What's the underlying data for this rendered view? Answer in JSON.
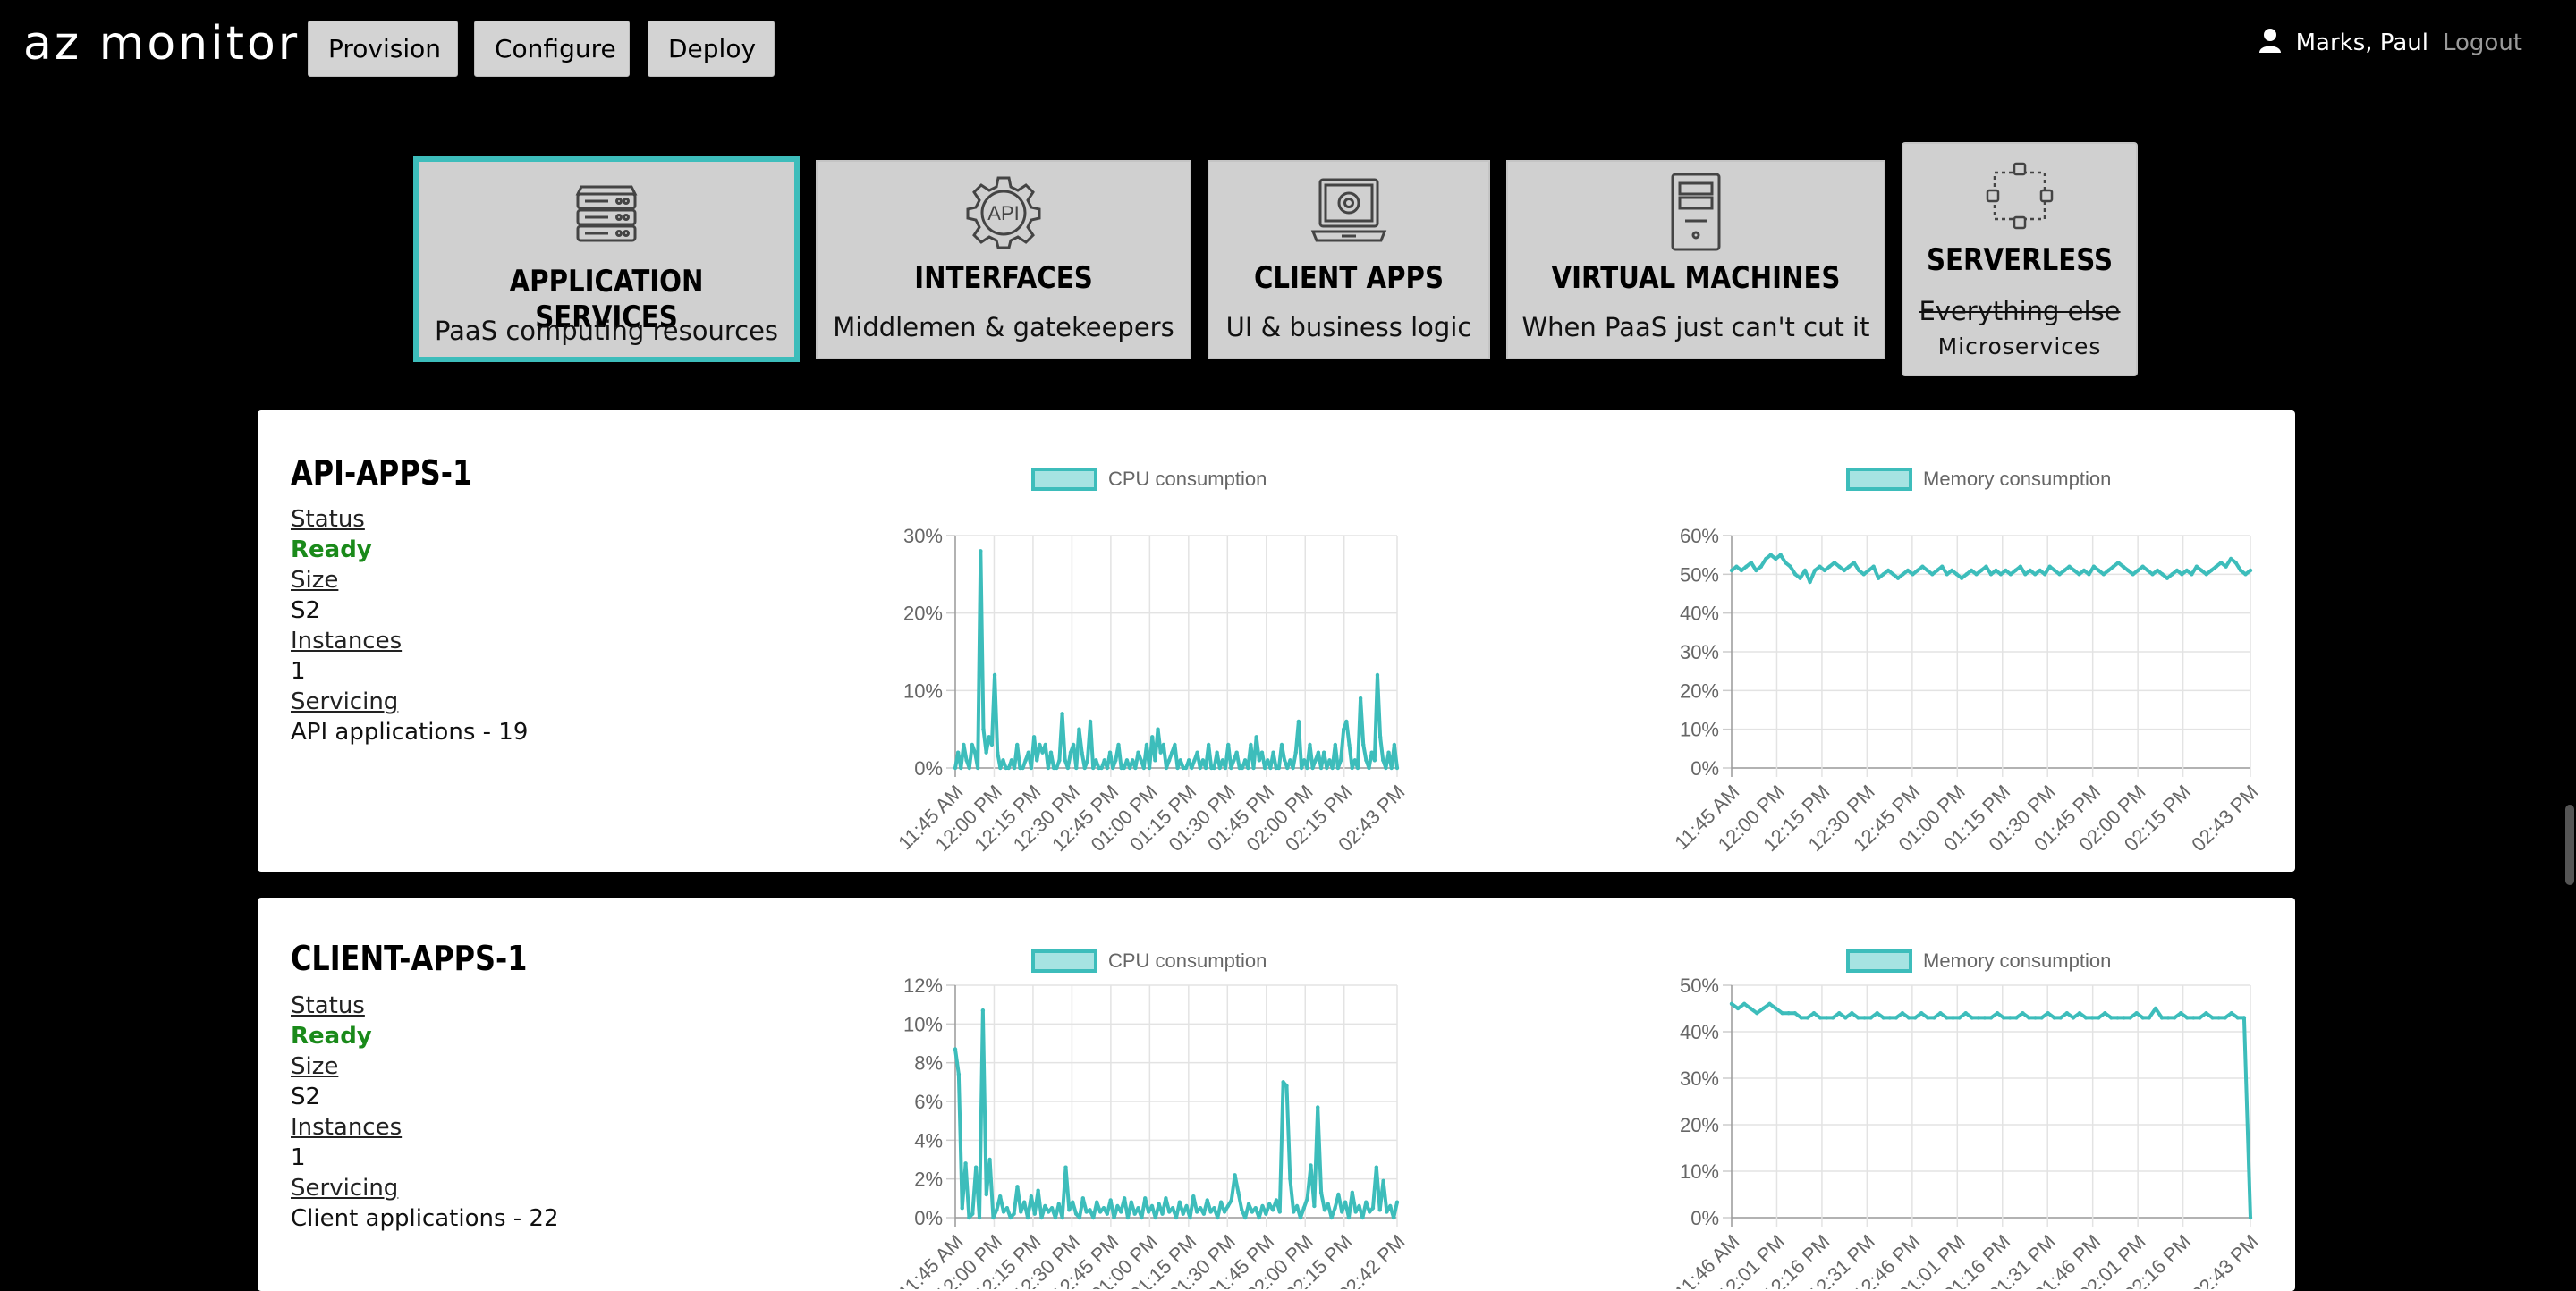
{
  "app": {
    "title": "az monitor"
  },
  "nav": {
    "provision": "Provision",
    "configure": "Configure",
    "deploy": "Deploy"
  },
  "user": {
    "icon": "user-icon",
    "name": "Marks, Paul",
    "logout": "Logout"
  },
  "tiles": [
    {
      "icon": "server-rack-icon",
      "title": "APPLICATION SERVICES",
      "subtitle": "PaaS computing resources",
      "active": true
    },
    {
      "icon": "api-gear-icon",
      "title": "INTERFACES",
      "subtitle": "Middlemen & gatekeepers",
      "active": false
    },
    {
      "icon": "laptop-browser-icon",
      "title": "CLIENT APPS",
      "subtitle": "UI & business logic",
      "active": false
    },
    {
      "icon": "tower-pc-icon",
      "title": "VIRTUAL MACHINES",
      "subtitle": "When PaaS just can't cut it",
      "active": false
    },
    {
      "icon": "dashed-nodes-icon",
      "title": "SERVERLESS",
      "subtitle": "Everything else",
      "subtitle2": "Microservices",
      "active": false
    }
  ],
  "resources": [
    {
      "name": "API-APPS-1",
      "labels": {
        "status": "Status",
        "size": "Size",
        "instances": "Instances",
        "servicing": "Servicing"
      },
      "status": "Ready",
      "size": "S2",
      "instances": "1",
      "servicing": "API applications - 19"
    },
    {
      "name": "CLIENT-APPS-1",
      "labels": {
        "status": "Status",
        "size": "Size",
        "instances": "Instances",
        "servicing": "Servicing"
      },
      "status": "Ready",
      "size": "S2",
      "instances": "1",
      "servicing": "Client applications - 22"
    }
  ],
  "colors": {
    "accent": "#3dbdbb",
    "legend_fill": "#a6e3e2",
    "ready": "#1a8a1a"
  },
  "chart_data": [
    {
      "type": "line",
      "legend": "CPU consumption",
      "yticks": [
        "0%",
        "10%",
        "20%",
        "30%"
      ],
      "ylim": [
        0,
        30
      ],
      "xticks": [
        "11:45 AM",
        "12:00 PM",
        "12:15 PM",
        "12:30 PM",
        "12:45 PM",
        "01:00 PM",
        "01:15 PM",
        "01:30 PM",
        "01:45 PM",
        "02:00 PM",
        "02:15 PM",
        "02:43 PM"
      ],
      "values": [
        0,
        2,
        0,
        3,
        1,
        0,
        3,
        2,
        0,
        28,
        5,
        2,
        4,
        3,
        12,
        2,
        0,
        1,
        0,
        0,
        1,
        0,
        3,
        0,
        0,
        1,
        2,
        0,
        4,
        1,
        3,
        2,
        3,
        0,
        2,
        0,
        0,
        1,
        7,
        1,
        0,
        2,
        3,
        0,
        5,
        2,
        0,
        1,
        6,
        0,
        1,
        0,
        0,
        1,
        0,
        2,
        0,
        1,
        3,
        0,
        0,
        1,
        0,
        1,
        0,
        2,
        1,
        0,
        3,
        0,
        4,
        1,
        5,
        2,
        3,
        0,
        1,
        2,
        3,
        0,
        1,
        0,
        0,
        1,
        0,
        1,
        2,
        0,
        1,
        0,
        3,
        0,
        0,
        2,
        0,
        1,
        0,
        3,
        0,
        1,
        2,
        0,
        0,
        1,
        0,
        3,
        0,
        4,
        1,
        2,
        0,
        1,
        0,
        2,
        0,
        0,
        3,
        1,
        0,
        1,
        0,
        2,
        6,
        0,
        1,
        0,
        3,
        0,
        1,
        2,
        0,
        2,
        0,
        1,
        0,
        3,
        0,
        1,
        5,
        6,
        3,
        0,
        1,
        0,
        9,
        3,
        1,
        0,
        2,
        1,
        12,
        4,
        1,
        0,
        2,
        0,
        3,
        0
      ],
      "grid": true,
      "legend_position": "top"
    },
    {
      "type": "line",
      "legend": "Memory consumption",
      "yticks": [
        "0%",
        "10%",
        "20%",
        "30%",
        "40%",
        "50%",
        "60%"
      ],
      "ylim": [
        0,
        60
      ],
      "xticks": [
        "11:45 AM",
        "12:00 PM",
        "12:15 PM",
        "12:30 PM",
        "12:45 PM",
        "01:00 PM",
        "01:15 PM",
        "01:30 PM",
        "01:45 PM",
        "02:00 PM",
        "02:15 PM",
        "02:43 PM"
      ],
      "values": [
        51,
        52,
        51,
        52,
        53,
        51,
        52,
        54,
        55,
        54,
        55,
        53,
        52,
        50,
        49,
        51,
        48,
        51,
        52,
        51,
        52,
        53,
        52,
        51,
        52,
        53,
        51,
        50,
        51,
        52,
        49,
        50,
        51,
        50,
        49,
        50,
        51,
        50,
        51,
        52,
        51,
        50,
        51,
        52,
        50,
        51,
        50,
        49,
        50,
        51,
        50,
        51,
        52,
        50,
        51,
        50,
        51,
        50,
        51,
        52,
        50,
        51,
        50,
        51,
        50,
        52,
        51,
        50,
        51,
        52,
        51,
        50,
        51,
        50,
        52,
        51,
        50,
        51,
        52,
        53,
        52,
        51,
        50,
        51,
        52,
        51,
        50,
        51,
        50,
        49,
        50,
        51,
        50,
        51,
        50,
        52,
        51,
        50,
        51,
        52,
        53,
        52,
        54,
        53,
        51,
        50,
        51
      ],
      "grid": true,
      "legend_position": "top"
    },
    {
      "type": "line",
      "legend": "CPU consumption",
      "yticks": [
        "0%",
        "2%",
        "4%",
        "6%",
        "8%",
        "10%",
        "12%"
      ],
      "ylim": [
        0,
        12
      ],
      "xticks": [
        "11:45 AM",
        "12:00 PM",
        "12:15 PM",
        "12:30 PM",
        "12:45 PM",
        "01:00 PM",
        "01:15 PM",
        "01:30 PM",
        "01:45 PM",
        "02:00 PM",
        "02:15 PM",
        "02:42 PM"
      ],
      "values": [
        8.7,
        7.4,
        0.5,
        2.8,
        0,
        0.2,
        2.6,
        0,
        10.7,
        1.2,
        3,
        0,
        0.4,
        1.1,
        0.3,
        0.5,
        0,
        0.2,
        1.6,
        0.3,
        0.8,
        0,
        1.1,
        0.2,
        1.4,
        0,
        0.6,
        0.3,
        0.5,
        0,
        0.7,
        0,
        2.6,
        0.4,
        0.8,
        0.2,
        0,
        1,
        0.3,
        0.4,
        0,
        0.8,
        0.3,
        0.5,
        0.2,
        0.9,
        0,
        0.6,
        0.3,
        1,
        0,
        0.8,
        0.2,
        0.5,
        0,
        1,
        0.3,
        0.6,
        0,
        0.7,
        0.2,
        1,
        0.3,
        0.5,
        0,
        0.8,
        0.2,
        0.6,
        0,
        1.1,
        0.3,
        0.5,
        0.2,
        0.9,
        0.3,
        0.5,
        0,
        0.8,
        0.3,
        0.6,
        0.9,
        2.2,
        1.3,
        0.4,
        0,
        0.7,
        0.3,
        0.5,
        0,
        0.6,
        0.2,
        0.7,
        0.4,
        0.9,
        0.3,
        7,
        6.8,
        2,
        0.3,
        0.6,
        0,
        0.5,
        1,
        2.7,
        0.6,
        5.7,
        1.3,
        0.4,
        0.7,
        0,
        0.5,
        1.2,
        0.3,
        0.8,
        0,
        1.3,
        0.3,
        0.6,
        0,
        0.8,
        0.3,
        0.5,
        2.6,
        0.4,
        1.9,
        0.3,
        0.6,
        0,
        0.8
      ],
      "grid": true,
      "legend_position": "top"
    },
    {
      "type": "line",
      "legend": "Memory consumption",
      "yticks": [
        "0%",
        "10%",
        "20%",
        "30%",
        "40%",
        "50%"
      ],
      "ylim": [
        0,
        50
      ],
      "xticks": [
        "11:46 AM",
        "12:01 PM",
        "12:16 PM",
        "12:31 PM",
        "12:46 PM",
        "01:01 PM",
        "01:16 PM",
        "01:31 PM",
        "01:46 PM",
        "02:01 PM",
        "02:16 PM",
        "02:43 PM"
      ],
      "values": [
        46,
        45,
        46,
        45,
        44,
        45,
        46,
        45,
        44,
        44,
        44,
        43,
        43,
        44,
        43,
        43,
        43,
        44,
        43,
        44,
        43,
        43,
        43,
        44,
        43,
        43,
        43,
        44,
        43,
        43,
        44,
        43,
        43,
        44,
        43,
        43,
        43,
        44,
        43,
        43,
        43,
        43,
        44,
        43,
        43,
        43,
        44,
        43,
        43,
        43,
        44,
        43,
        43,
        44,
        43,
        44,
        43,
        43,
        43,
        44,
        43,
        43,
        43,
        43,
        44,
        43,
        43,
        45,
        43,
        43,
        43,
        44,
        43,
        43,
        43,
        44,
        43,
        43,
        43,
        44,
        43,
        43,
        0
      ],
      "grid": true,
      "legend_position": "top"
    }
  ]
}
